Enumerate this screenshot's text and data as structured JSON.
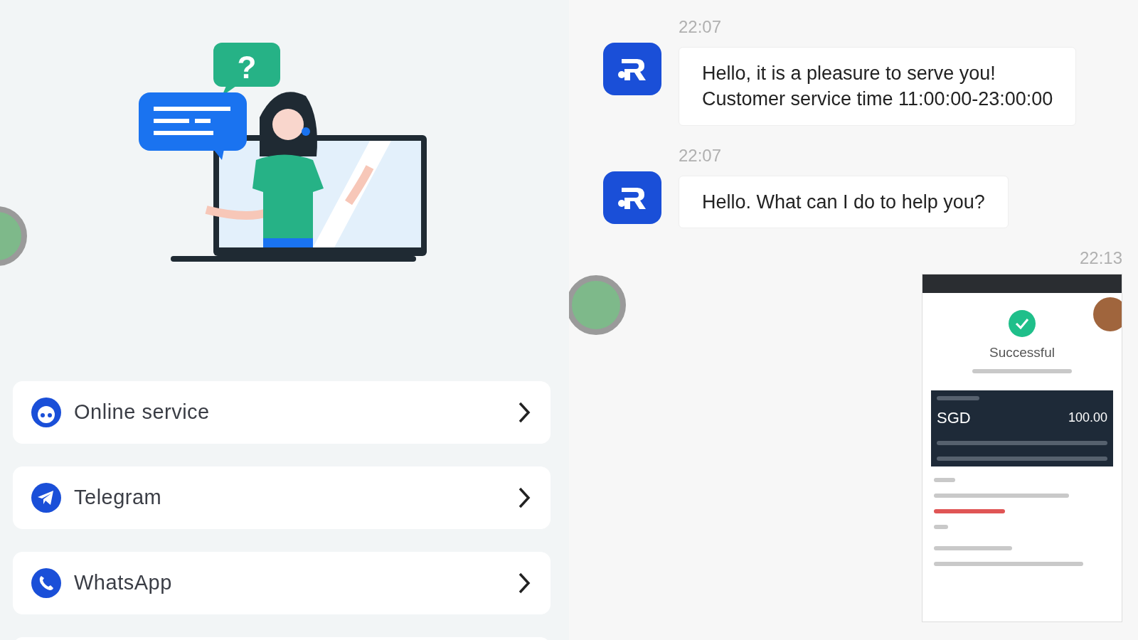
{
  "support_panel": {
    "illustration": {
      "bubble_mark": "?"
    },
    "menu": [
      {
        "kind": "agent",
        "label": "Online service"
      },
      {
        "kind": "telegram",
        "label": "Telegram"
      },
      {
        "kind": "whatsapp",
        "label": "WhatsApp"
      },
      {
        "kind": "partial"
      }
    ]
  },
  "chat": {
    "messages": [
      {
        "time": "22:07",
        "outgoing": false,
        "kind": "text",
        "text": "Hello, it is a pleasure to serve you!\nCustomer service time 11:00:00-23:00:00"
      },
      {
        "time": "22:07",
        "outgoing": false,
        "kind": "text",
        "text": "Hello. What can I do to help you?"
      },
      {
        "time": "22:13",
        "outgoing": true,
        "kind": "image",
        "image": {
          "status": "Successful",
          "currency": "SGD",
          "amount": "100.00"
        }
      }
    ]
  }
}
